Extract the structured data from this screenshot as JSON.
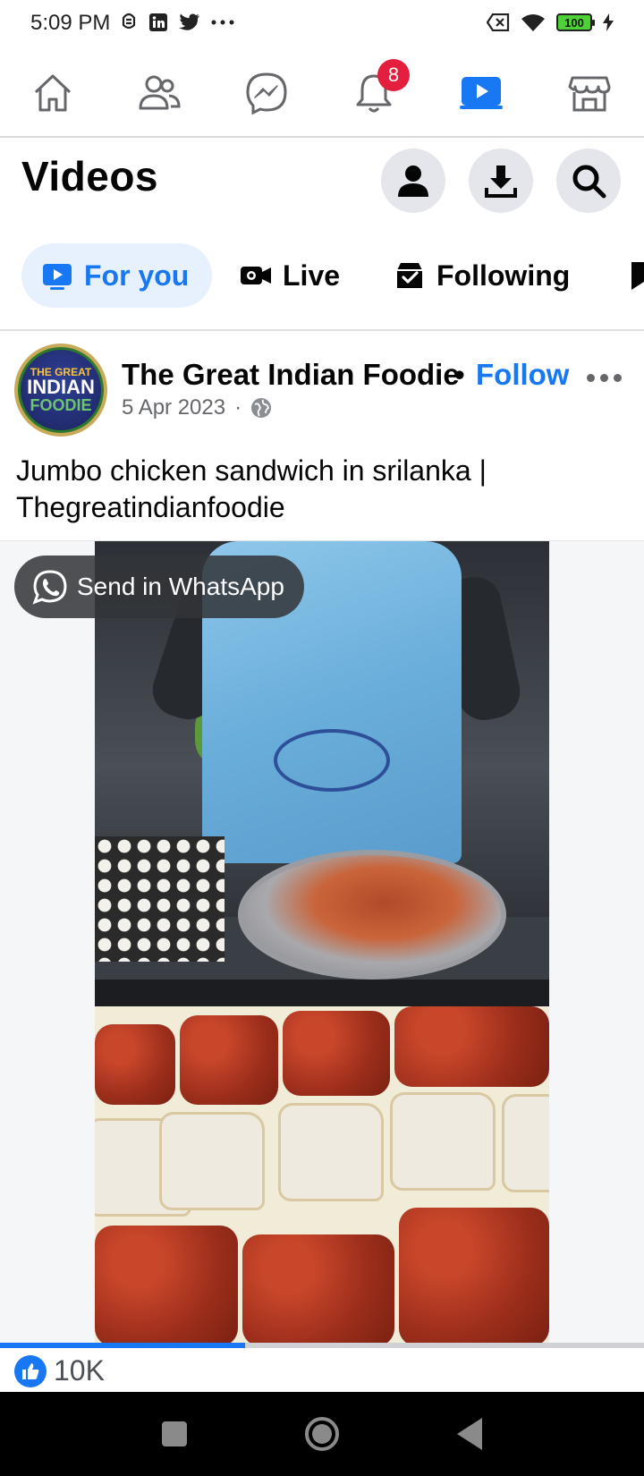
{
  "status_bar": {
    "time": "5:09 PM",
    "left_icons": [
      "alarm-icon",
      "linkedin-icon",
      "twitter-icon",
      "more-dots-icon"
    ],
    "right_icons": [
      "sim-off-icon",
      "wifi-icon",
      "battery-icon",
      "charging-icon"
    ],
    "battery_level": "100"
  },
  "top_nav": {
    "items": [
      {
        "name": "home",
        "icon": "home-icon",
        "active": false
      },
      {
        "name": "friends",
        "icon": "friends-icon",
        "active": false
      },
      {
        "name": "messenger",
        "icon": "messenger-icon",
        "active": false
      },
      {
        "name": "notifications",
        "icon": "bell-icon",
        "active": false,
        "badge": "8"
      },
      {
        "name": "video",
        "icon": "video-play-icon",
        "active": true
      },
      {
        "name": "marketplace",
        "icon": "marketplace-icon",
        "active": false
      }
    ],
    "notifications_badge": "8",
    "accent_color": "#1877f2"
  },
  "header": {
    "title": "Videos",
    "actions": [
      "profile-icon",
      "download-icon",
      "search-icon"
    ]
  },
  "tabs": [
    {
      "label": "For you",
      "icon": "video-play-icon",
      "active": true
    },
    {
      "label": "Live",
      "icon": "live-camera-icon",
      "active": false
    },
    {
      "label": "Following",
      "icon": "following-icon",
      "active": false
    },
    {
      "label": "",
      "icon": "bookmark-icon",
      "active": false
    }
  ],
  "post": {
    "author": "The Great Indian Foodie",
    "separator": "•",
    "follow_label": "Follow",
    "date": "5 Apr 2023",
    "date_separator": "·",
    "audience_icon": "globe-icon",
    "avatar": {
      "line1": "THE GREAT",
      "line2": "INDIAN",
      "line3": "FOODIE"
    },
    "caption": "Jumbo chicken sandwich in srilanka | Thegreatindianfoodie",
    "video": {
      "share_chip": "Send in WhatsApp",
      "share_icon": "whatsapp-icon",
      "progress_fraction": 0.38
    },
    "reactions": {
      "icon": "like-thumb-icon",
      "count": "10K"
    }
  },
  "system_nav": [
    "recents-square-icon",
    "home-circle-icon",
    "back-triangle-icon"
  ]
}
